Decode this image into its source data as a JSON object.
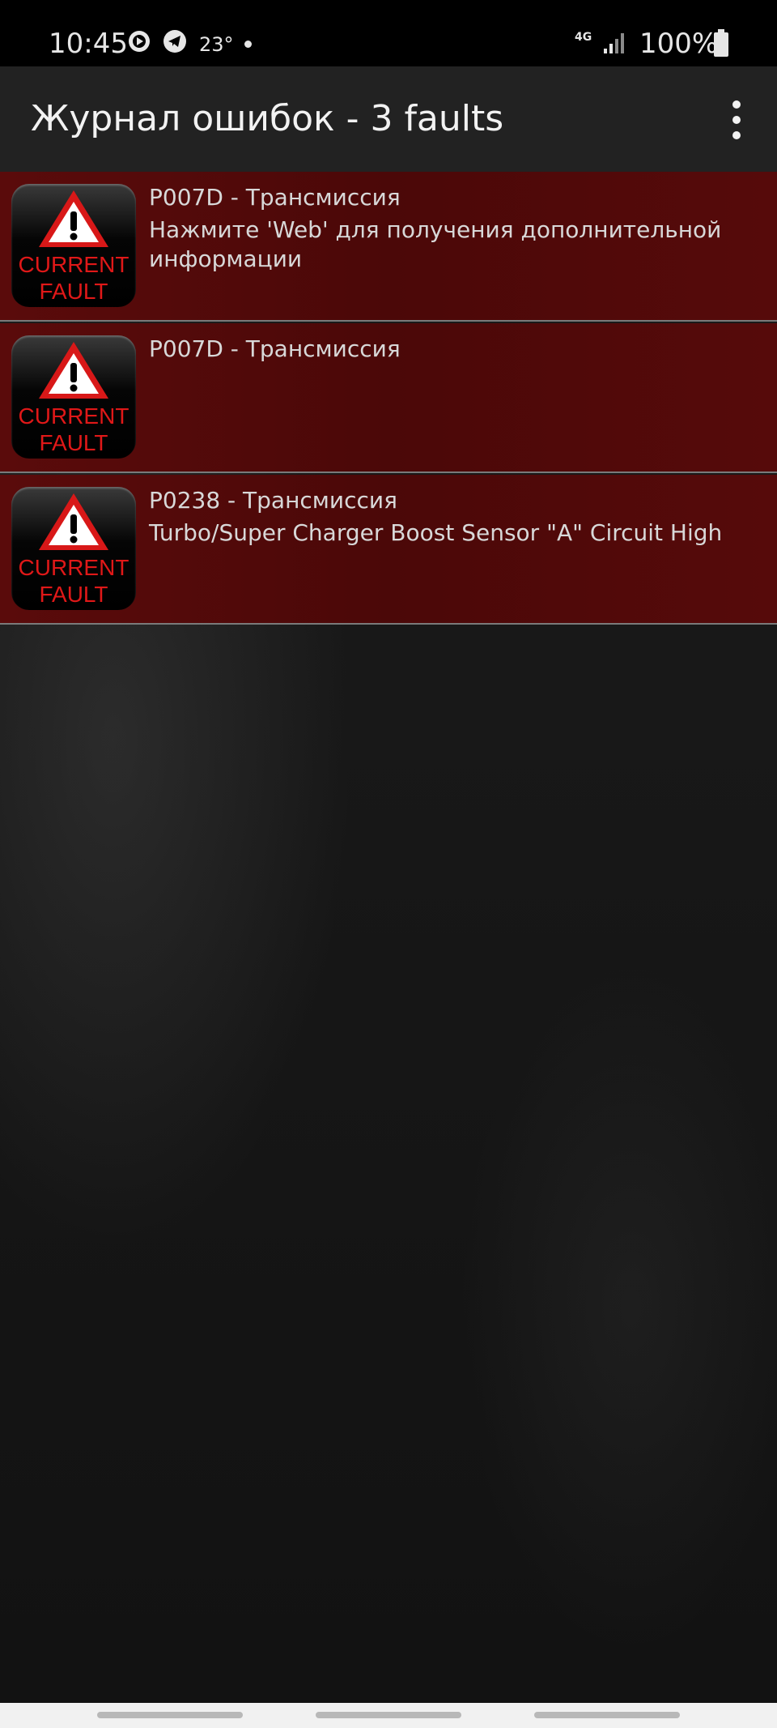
{
  "status_bar": {
    "time": "10:45",
    "temperature": "23°",
    "network": "4G",
    "battery": "100%",
    "icons": [
      "play-circle-icon",
      "telegram-icon",
      "notification-dot-icon",
      "signal-icon",
      "battery-icon"
    ]
  },
  "app_bar": {
    "title": "Журнал ошибок - 3 faults",
    "menu_icon": "more-vert-icon"
  },
  "faults": [
    {
      "badge_line1": "CURRENT",
      "badge_line2": "FAULT",
      "code": "P007D - Трансмиссия",
      "description": "Нажмите 'Web' для получения дополнительной информации"
    },
    {
      "badge_line1": "CURRENT",
      "badge_line2": "FAULT",
      "code": "P007D - Трансмиссия",
      "description": ""
    },
    {
      "badge_line1": "CURRENT",
      "badge_line2": "FAULT",
      "code": "P0238 - Трансмиссия",
      "description": "Turbo/Super Charger Boost Sensor \"A\" Circuit High"
    }
  ],
  "colors": {
    "fault_row": "#500909",
    "badge_text": "#e01818",
    "app_bar": "#222222"
  }
}
